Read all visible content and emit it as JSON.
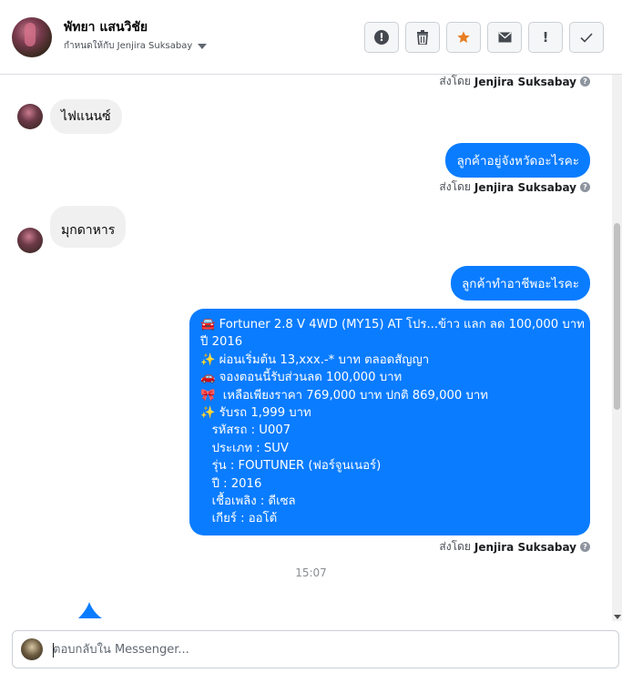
{
  "header": {
    "contact_name": "พัทยา แสนวิชัย",
    "assigned_to": "กำหนดให้กับ Jenjira Suksabay",
    "actions": [
      {
        "name": "report-spam-button",
        "icon": "alert-circle-icon"
      },
      {
        "name": "delete-button",
        "icon": "trash-icon"
      },
      {
        "name": "star-button",
        "icon": "star-icon"
      },
      {
        "name": "mark-unread-button",
        "icon": "envelope-icon"
      },
      {
        "name": "follow-up-button",
        "icon": "exclamation-icon"
      },
      {
        "name": "mark-done-button",
        "icon": "check-icon"
      }
    ],
    "colors": {
      "star": "#e87e22"
    }
  },
  "sent_by": {
    "prefix": "ส่งโดย",
    "name": "Jenjira Suksabay"
  },
  "messages": {
    "in_1": "ไฟแนนซ์",
    "out_1": "ลูกค้าอยู่จังหวัดอะไรคะ",
    "in_2": "มุกดาหาร",
    "out_2": "ลูกค้าทำอาชีพอะไรคะ",
    "long_lines": [
      "🚘 Fortuner 2.8 V 4WD (MY15) AT โปร...ข้าว แลก ลด 100,000 บาท",
      "ปี 2016",
      "✨ ผ่อนเริ่มต้น 13,xxx.-* บาท ตลอดสัญญา",
      "🚗 จองตอนนี้รับส่วนลด 100,000 บาท",
      "🎀  เหลือเพียงราคา 769,000 บาท ปกติ 869,000 บาท",
      "✨ รับรถ 1,999 บาท",
      "   รหัสรถ : U007",
      "   ประเภท : SUV",
      "   รุ่น : FOUTUNER (ฟอร์จูนเนอร์)",
      "   ปี : 2016",
      "   เชื้อเพลิง : ดีเซล",
      "   เกียร์ : ออโต้"
    ]
  },
  "timestamp": "15:07",
  "composer": {
    "placeholder": "ตอบกลับใน Messenger..."
  },
  "colors": {
    "outgoing_bubble": "#0a7cff",
    "incoming_bubble": "#f0f0f0"
  }
}
